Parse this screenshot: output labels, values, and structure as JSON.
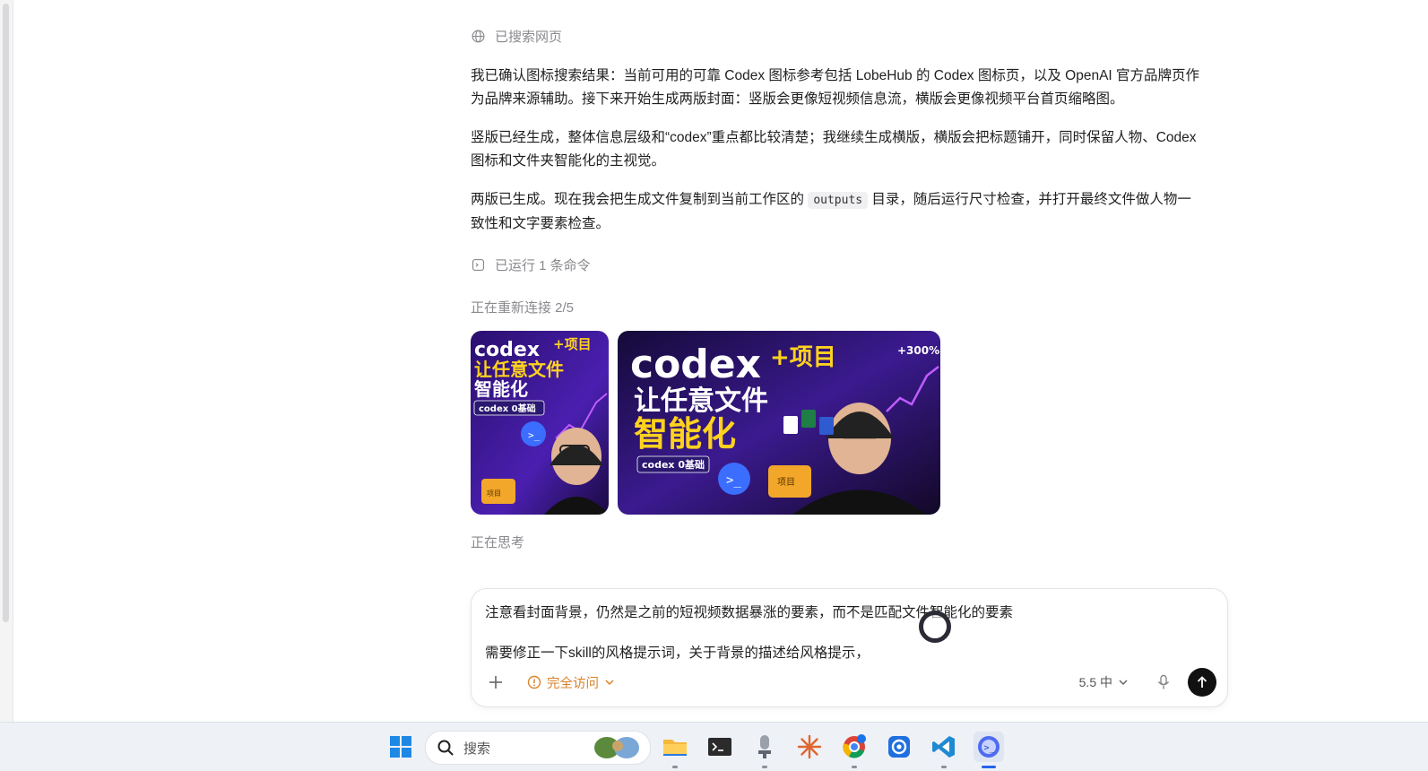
{
  "conversation": {
    "step_search": "已搜索网页",
    "para1_line1": "我已确认图标搜索结果：当前可用的可靠 Codex 图标参考包括 LobeHub 的 Codex 图标页，以及 OpenAI 官方品牌页作",
    "para1_line2": "为品牌来源辅助。接下来开始生成两版封面：竖版会更像短视频信息流，横版会更像视频平台首页缩略图。",
    "para2_line1": "竖版已经生成，整体信息层级和“codex”重点都比较清楚；我继续生成横版，横版会把标题铺开，同时保留人物、Codex",
    "para2_line2": "图标和文件夹智能化的主视觉。",
    "para3_before": "两版已生成。现在我会把生成文件复制到当前工作区的 ",
    "para3_code": "outputs",
    "para3_after": " 目录，随后运行尺寸检查，并打开最终文件做人物一",
    "para3_line2": "致性和文字要素检查。",
    "step_run": "已运行 1 条命令",
    "reconnecting": "正在重新连接 2/5",
    "thinking": "正在思考"
  },
  "thumbnails": {
    "vertical": {
      "title_top": "codex",
      "title_plus": "+项目",
      "title_line2": "让任意文件",
      "title_line3": "智能化",
      "badge": "codex 0基础",
      "folder_label": "项目"
    },
    "horizontal": {
      "title_top": "codex",
      "title_plus": "+项目",
      "title_line2": "让任意文件",
      "title_line3": "智能化",
      "badge": "codex 0基础",
      "folder_label": "项目",
      "stat": "+300%"
    }
  },
  "composer": {
    "line1": "注意看封面背景，仍然是之前的短视频数据暴涨的要素，而不是匹配文件智能化的要素",
    "line2": "需要修正一下skill的风格提示词，关于背景的描述给风格提示，",
    "access_label": "完全访问",
    "model_label": "5.5 中"
  },
  "taskbar": {
    "search_label": "搜索",
    "apps": [
      "start-icon",
      "file-explorer-icon",
      "terminal-icon",
      "microphone-app-icon",
      "claude-icon",
      "chrome-icon",
      "settings-app-icon",
      "vscode-icon",
      "codex-app-icon"
    ],
    "active_app": "codex-app-icon"
  },
  "colors": {
    "accent_orange": "#d9822b",
    "send_button": "#111111",
    "thumb_purple": "#3b1a8f",
    "thumb_yellow": "#ffd21f"
  }
}
